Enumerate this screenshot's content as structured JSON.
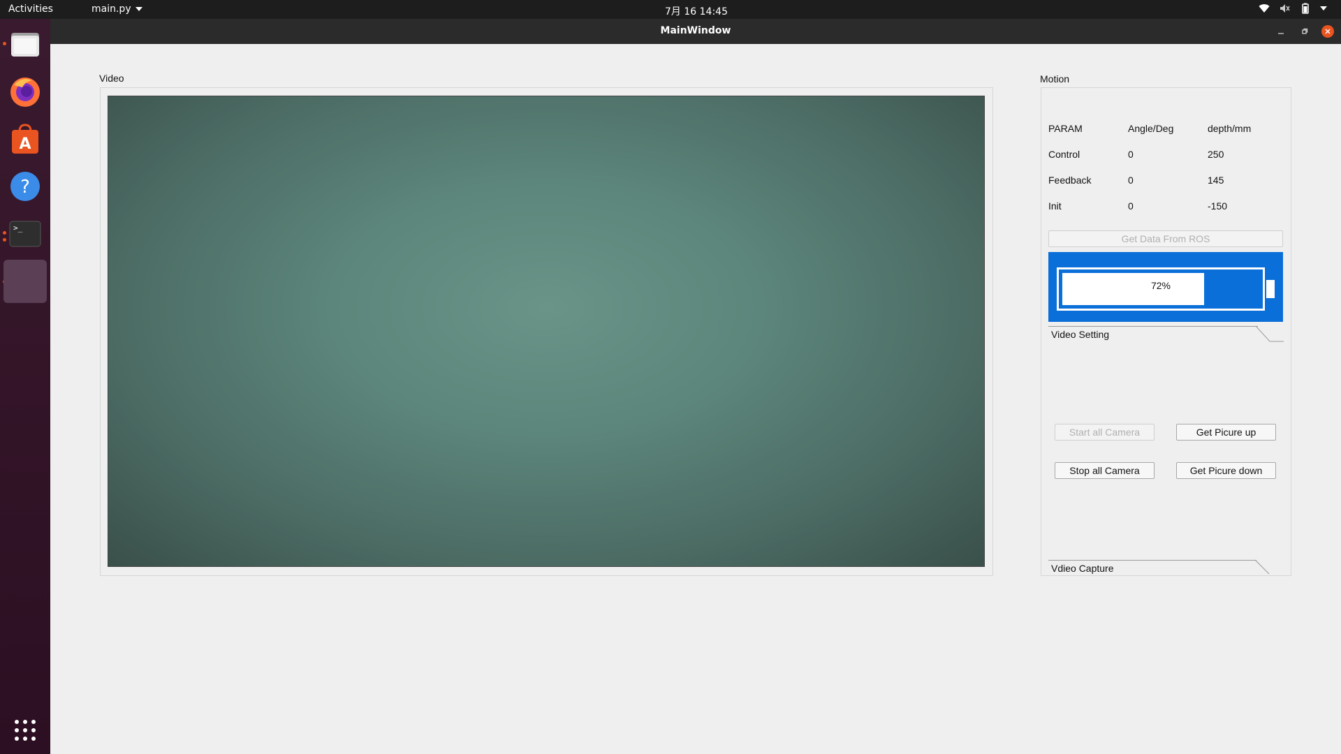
{
  "topbar": {
    "activities": "Activities",
    "app_menu": "main.py",
    "clock": "7月 16  14:45"
  },
  "dock": {
    "items": [
      {
        "name": "files-icon",
        "running": true
      },
      {
        "name": "firefox-icon",
        "running": false
      },
      {
        "name": "software-center-icon",
        "running": false
      },
      {
        "name": "help-icon",
        "running": false
      },
      {
        "name": "terminal-icon",
        "running": true
      },
      {
        "name": "python-app-icon",
        "running": true
      }
    ],
    "apps_grid": "show-applications-icon"
  },
  "window": {
    "title": "MainWindow"
  },
  "video": {
    "group_label": "Video"
  },
  "motion": {
    "group_label": "Motion",
    "table": {
      "headers": [
        "PARAM",
        "Angle/Deg",
        "depth/mm"
      ],
      "rows": [
        [
          "Control",
          "0",
          "250"
        ],
        [
          "Feedback",
          "0",
          "145"
        ],
        [
          "Init",
          "0",
          "-150"
        ]
      ]
    },
    "get_data_button": "Get Data From ROS",
    "battery": {
      "level": 0.72,
      "text": "72%",
      "color": "#0a6fd8"
    }
  },
  "video_setting": {
    "tab_label": "Video Setting",
    "start_all_camera": "Start all Camera",
    "stop_all_camera": "Stop all Camera",
    "get_picture_up": "Get Picure up",
    "get_picture_down": "Get Picure down"
  },
  "video_capture": {
    "tab_label": "Vdieo Capture"
  }
}
